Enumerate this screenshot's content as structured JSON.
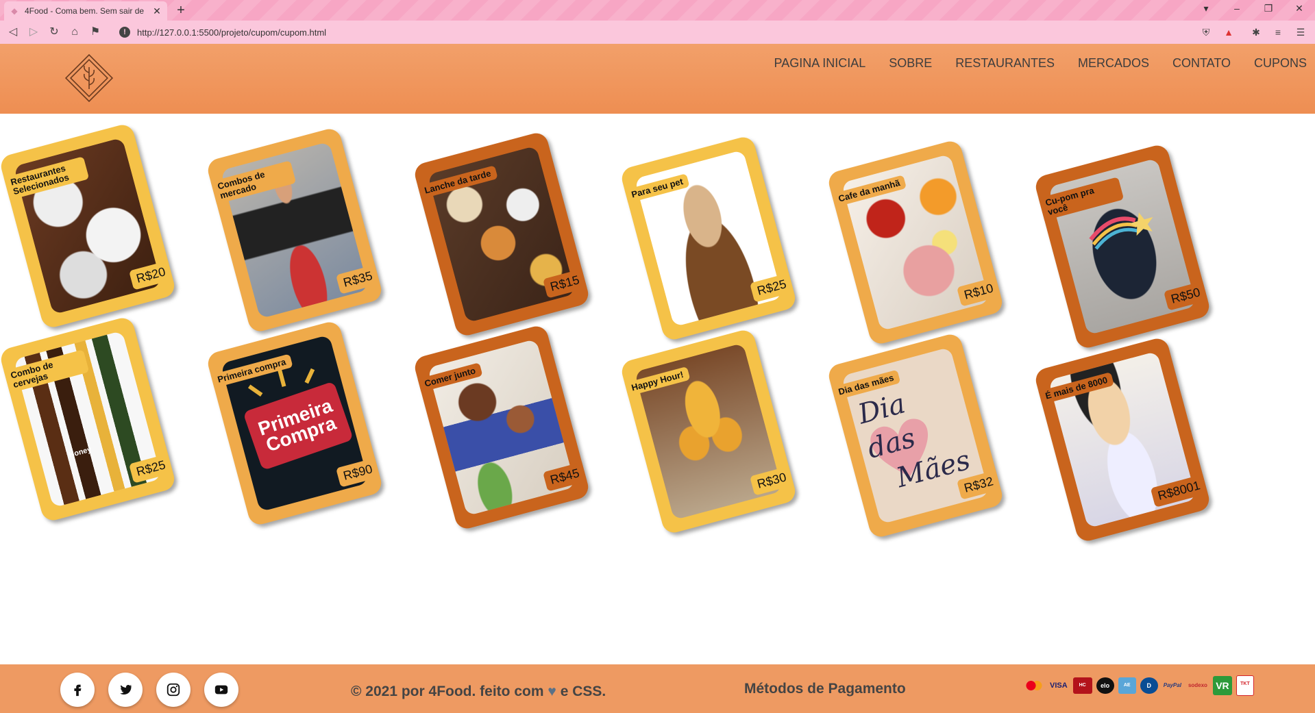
{
  "browser": {
    "tab_title": "4Food - Coma bem. Sem sair de",
    "url": "http://127.0.0.1:5500/projeto/cupom/cupom.html"
  },
  "nav": {
    "items": [
      "PAGINA INICIAL",
      "SOBRE",
      "RESTAURANTES",
      "MERCADOS",
      "CONTATO",
      "CUPONS"
    ]
  },
  "coupons": [
    {
      "name": "Restaurantes Selecionados",
      "price": "R$20"
    },
    {
      "name": "Combos de mercado",
      "price": "R$35"
    },
    {
      "name": "Lanche da tarde",
      "price": "R$15"
    },
    {
      "name": "Para seu pet",
      "price": "R$25"
    },
    {
      "name": "Cafe da manhã",
      "price": "R$10"
    },
    {
      "name": "Cu-pom pra você",
      "price": "R$50"
    },
    {
      "name": "Combo de cervejas",
      "price": "R$25"
    },
    {
      "name": "Primeira compra",
      "price": "R$90"
    },
    {
      "name": "Comer junto",
      "price": "R$45"
    },
    {
      "name": "Happy Hour!",
      "price": "R$30"
    },
    {
      "name": "Dia das mães",
      "price": "R$32"
    },
    {
      "name": "É mais de 8000",
      "price": "R$8001"
    }
  ],
  "coupon_art": {
    "primeira_line1": "Primeira",
    "primeira_line2": "Compra",
    "maes_line1": "Dia das",
    "maes_line2": "Mães",
    "beer_label": "Honey"
  },
  "footer": {
    "copyright_prefix": "© 2021 por 4Food. feito com",
    "copyright_suffix": "e CSS.",
    "payment_title": "Métodos de Pagamento",
    "payment_methods": [
      "mastercard",
      "VISA",
      "Hipercard",
      "elo",
      "amex",
      "Diners",
      "PayPal",
      "sodexo",
      "VR",
      "Ticket"
    ]
  },
  "colors": {
    "header": "#ee8e52",
    "footer": "#ee9a62",
    "card_yellow": "#f5c248",
    "card_orange": "#efaa4a",
    "card_rust": "#c9641d"
  }
}
